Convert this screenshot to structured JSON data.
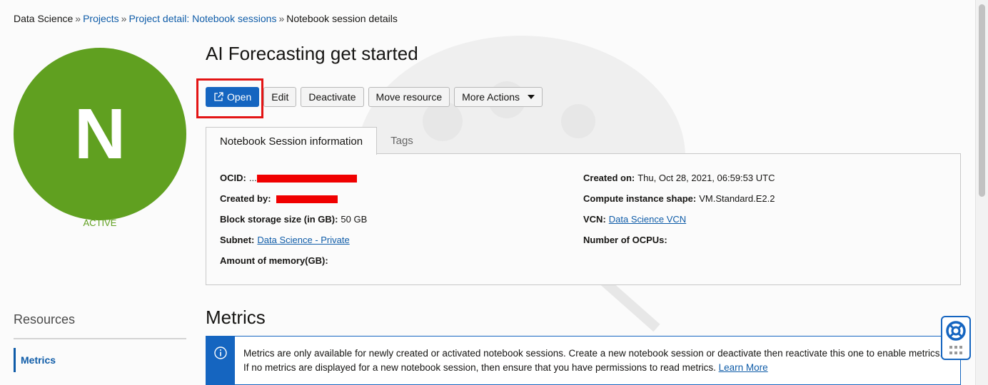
{
  "breadcrumb": {
    "root": "Data Science",
    "separator": "»",
    "projects": "Projects",
    "project_detail": "Project detail: Notebook sessions",
    "current": "Notebook session details"
  },
  "avatar": {
    "letter": "N",
    "color": "#60a020"
  },
  "status": "ACTIVE",
  "title": "AI Forecasting get started",
  "toolbar": {
    "open": "Open",
    "edit": "Edit",
    "deactivate": "Deactivate",
    "move_resource": "Move resource",
    "more_actions": "More Actions"
  },
  "tabs": {
    "info": "Notebook Session information",
    "tags": "Tags"
  },
  "info": {
    "ocid_label": "OCID:",
    "ocid_value": "...",
    "created_by_label": "Created by:",
    "block_storage_label": "Block storage size (in GB):",
    "block_storage_value": "50 GB",
    "subnet_label": "Subnet:",
    "subnet_value": "Data Science - Private",
    "memory_label": "Amount of memory(GB):",
    "created_on_label": "Created on:",
    "created_on_value": "Thu, Oct 28, 2021, 06:59:53 UTC",
    "shape_label": "Compute instance shape:",
    "shape_value": "VM.Standard.E2.2",
    "vcn_label": "VCN:",
    "vcn_value": "Data Science VCN",
    "ocpus_label": "Number of OCPUs:"
  },
  "resources": {
    "label": "Resources",
    "metrics_link": "Metrics"
  },
  "metrics": {
    "title": "Metrics",
    "alert_line1": "Metrics are only available for newly created or activated notebook sessions. Create a new notebook session or deactivate then reactivate this one to enable metrics.",
    "alert_line2": "If no metrics are displayed for a new notebook session, then ensure that you have permissions to read metrics.",
    "learn_more": "Learn More"
  },
  "colors": {
    "accent": "#1565c0",
    "link": "#0f5ca8",
    "active_green": "#60a020",
    "highlight_red": "#e31414"
  }
}
